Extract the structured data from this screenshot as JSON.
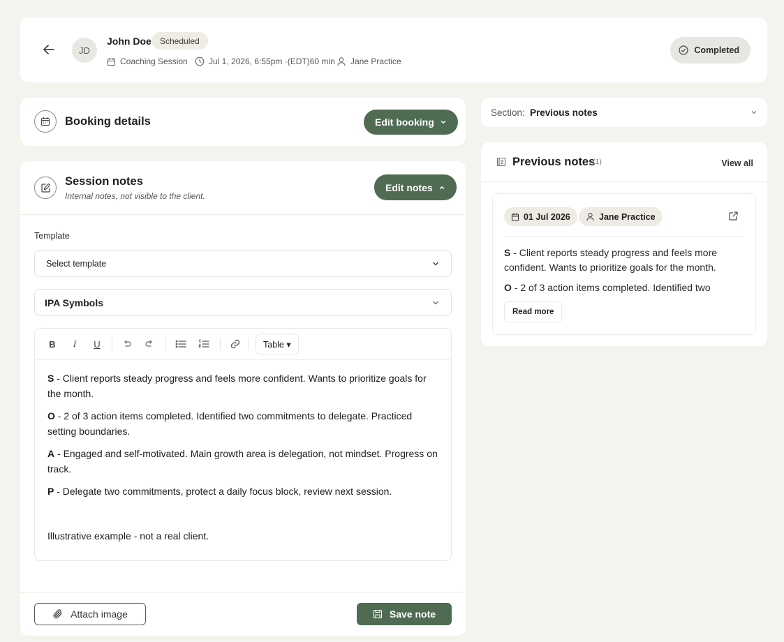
{
  "header": {
    "avatar_initials": "JD",
    "client_name": "John Doe",
    "status": "Scheduled",
    "session_type": "Coaching Session",
    "datetime": "Jul 1, 2026, 6:55pm ·(EDT)60 min",
    "practitioner": "Jane Practice",
    "completed_label": "Completed"
  },
  "booking": {
    "title": "Booking details",
    "edit_label": "Edit booking"
  },
  "notes": {
    "title": "Session notes",
    "subtitle": "Internal notes, not visible to the client.",
    "edit_label": "Edit notes",
    "template_label": "Template",
    "template_placeholder": "Select template",
    "ipa_label": "IPA Symbols",
    "toolbar": {
      "bold": "B",
      "italic": "I",
      "underline": "U",
      "table": "Table ▾"
    },
    "content": {
      "s_letter": "S",
      "s_text": " - Client reports steady progress and feels more confident. Wants to prioritize goals for the month.",
      "o_letter": "O",
      "o_text": " - 2 of 3 action items completed. Identified two commitments to delegate. Practiced setting boundaries.",
      "a_letter": "A",
      "a_text": " - Engaged and self-motivated. Main growth area is delegation, not mindset. Progress on track.",
      "p_letter": "P",
      "p_text": " - Delegate two commitments, protect a daily focus block, review next session.",
      "footer": "Illustrative example - not a real client."
    },
    "attach_label": "Attach image",
    "save_label": "Save note"
  },
  "section": {
    "label": "Section:",
    "value": "Previous notes"
  },
  "previous_notes": {
    "title": "Previous notes",
    "count": "(1)",
    "view_all": "View all",
    "entry": {
      "date": "01 Jul 2026",
      "person": "Jane Practice",
      "s_letter": "S",
      "s_text": " - Client reports steady progress and feels more confident. Wants to prioritize goals for the month.",
      "o_letter": "O",
      "o_text": " - 2 of 3 action items completed. Identified two",
      "read_more": "Read more"
    }
  },
  "colors": {
    "background": "#f5f3ee",
    "accent_green": "#4f6b52",
    "badge_bg": "#efece5"
  },
  "icons": {
    "back": "arrow-left-icon",
    "calendar": "calendar-icon",
    "clock": "clock-icon",
    "user": "user-icon",
    "check": "check-circle-icon",
    "edit": "edit-square-icon",
    "chevron": "chevron-down-icon",
    "document": "document-icon",
    "external": "external-link-icon",
    "paperclip": "paperclip-icon",
    "save": "save-icon"
  }
}
